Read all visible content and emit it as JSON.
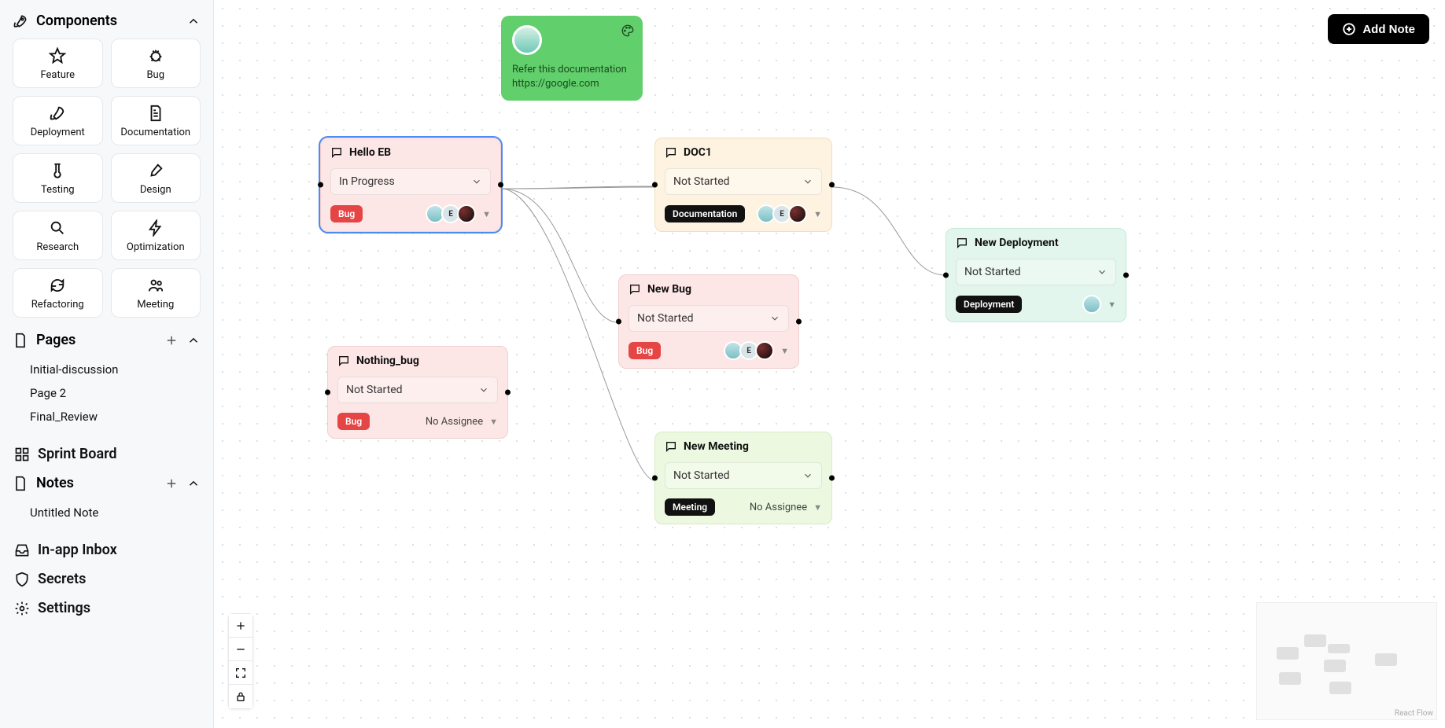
{
  "sidebar": {
    "components_title": "Components",
    "components": [
      {
        "label": "Feature",
        "icon": "star"
      },
      {
        "label": "Bug",
        "icon": "bug"
      },
      {
        "label": "Deployment",
        "icon": "rocket"
      },
      {
        "label": "Documentation",
        "icon": "doc"
      },
      {
        "label": "Testing",
        "icon": "tube"
      },
      {
        "label": "Design",
        "icon": "brush"
      },
      {
        "label": "Research",
        "icon": "search"
      },
      {
        "label": "Optimization",
        "icon": "bolt"
      },
      {
        "label": "Refactoring",
        "icon": "refresh"
      },
      {
        "label": "Meeting",
        "icon": "users"
      }
    ],
    "pages_title": "Pages",
    "pages": [
      "Initial-discussion",
      "Page 2",
      "Final_Review"
    ],
    "sprint_board": "Sprint Board",
    "notes_title": "Notes",
    "notes": [
      "Untitled Note"
    ],
    "inbox": "In-app Inbox",
    "secrets": "Secrets",
    "settings": "Settings"
  },
  "add_note_label": "Add Note",
  "minimap_attr": "React Flow",
  "sticky": {
    "text": "Refer this documentation",
    "url": "https://google.com"
  },
  "nodes": {
    "hello": {
      "title": "Hello EB",
      "status": "In Progress",
      "badge": "Bug"
    },
    "doc1": {
      "title": "DOC1",
      "status": "Not Started",
      "badge": "Documentation"
    },
    "newbug": {
      "title": "New Bug",
      "status": "Not Started",
      "badge": "Bug"
    },
    "nothing": {
      "title": "Nothing_bug",
      "status": "Not Started",
      "badge": "Bug",
      "no_assignee": "No Assignee"
    },
    "meeting": {
      "title": "New Meeting",
      "status": "Not Started",
      "badge": "Meeting",
      "no_assignee": "No Assignee"
    },
    "deploy": {
      "title": "New Deployment",
      "status": "Not Started",
      "badge": "Deployment"
    }
  }
}
